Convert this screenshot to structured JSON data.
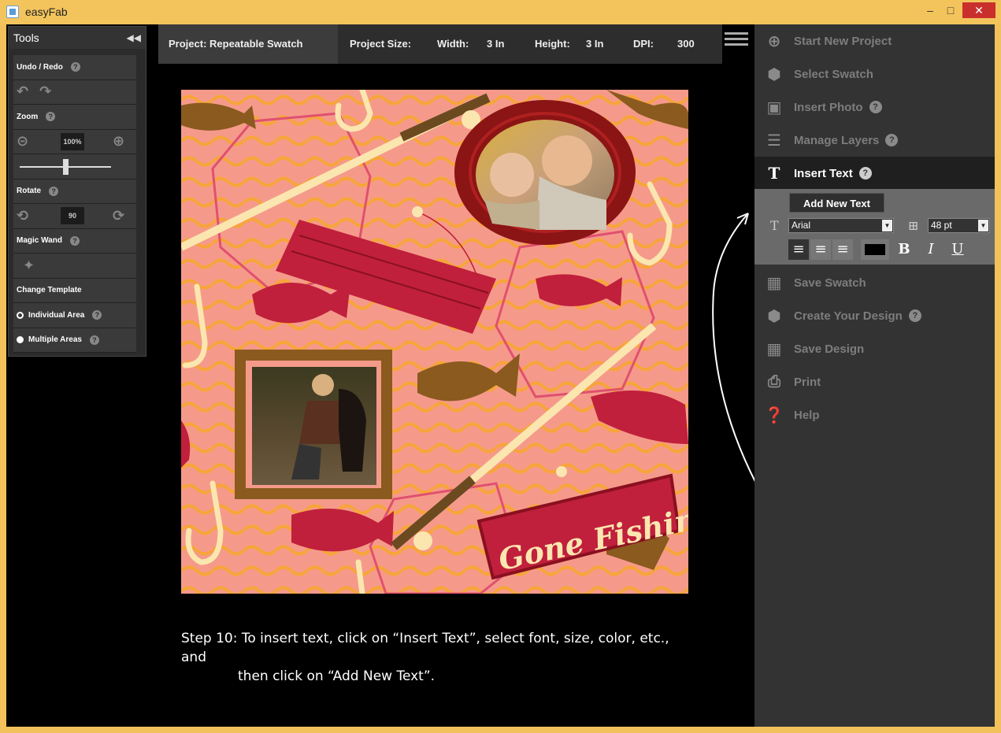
{
  "window": {
    "title": "easyFab"
  },
  "project_bar": {
    "project": "Project: Repeatable Swatch",
    "size_label": "Project Size:",
    "width_label": "Width:",
    "width_value": "3 In",
    "height_label": "Height:",
    "height_value": "3 In",
    "dpi_label": "DPI:",
    "dpi_value": "300"
  },
  "tools": {
    "title": "Tools",
    "undo_redo": "Undo / Redo",
    "zoom": "Zoom",
    "zoom_value": "100%",
    "zoom_slider_fraction": 0.5,
    "rotate": "Rotate",
    "rotate_value": "90",
    "magic_wand": "Magic Wand",
    "change_template": "Change Template",
    "individual_area": "Individual Area",
    "multiple_areas": "Multiple Areas",
    "help_glyph": "?"
  },
  "artwork": {
    "sign_text": "Gone Fishin'",
    "colors": {
      "background": "#f59a8a",
      "waves": "#f7a53a",
      "brown": "#8a5a1e",
      "crimson": "#c0203c",
      "cream": "#fbe6b0"
    }
  },
  "caption": {
    "line1": "Step 10: To insert text, click on “Insert Text”, select font, size, color, etc., and",
    "line2": "then click on “Add New Text”."
  },
  "menu": {
    "items": [
      {
        "label": "Start New Project",
        "icon": "plus-circle-icon",
        "help": false
      },
      {
        "label": "Select Swatch",
        "icon": "hexagon-icon",
        "help": false
      },
      {
        "label": "Insert Photo",
        "icon": "image-icon",
        "help": true
      },
      {
        "label": "Manage Layers",
        "icon": "layers-icon",
        "help": true
      },
      {
        "label": "Insert Text",
        "icon": "text-icon",
        "help": true,
        "active": true
      },
      {
        "label": "Save Swatch",
        "icon": "save-grid-icon",
        "help": false
      },
      {
        "label": "Create Your Design",
        "icon": "hexagon-icon",
        "help": true
      },
      {
        "label": "Save Design",
        "icon": "save-grid-icon",
        "help": false
      },
      {
        "label": "Print",
        "icon": "printer-icon",
        "help": false
      },
      {
        "label": "Help",
        "icon": "question-circle-icon",
        "help": false
      }
    ],
    "help_glyph": "?"
  },
  "text_panel": {
    "add_new_text": "Add New Text",
    "font": "Arial",
    "size": "48 pt",
    "text_color": "#000000",
    "bold": "B",
    "italic": "I",
    "underline": "U"
  },
  "annotation": {
    "step": "10"
  }
}
